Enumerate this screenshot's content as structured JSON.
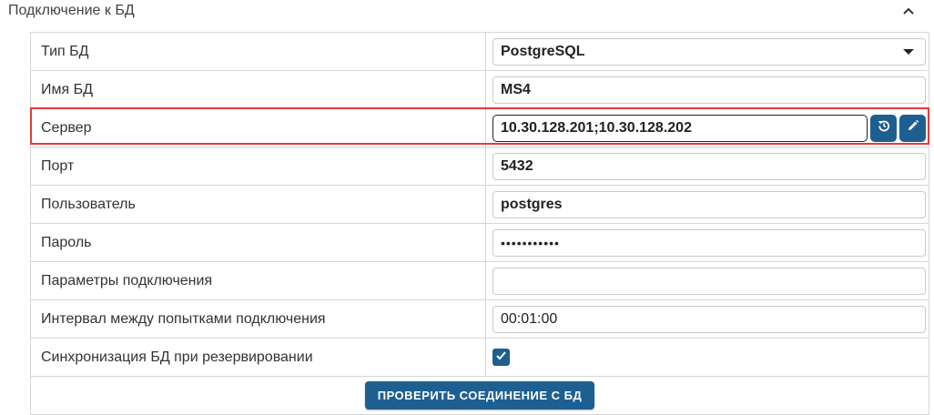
{
  "panel": {
    "title": "Подключение к БД"
  },
  "fields": {
    "db_type": {
      "label": "Тип БД",
      "value": "PostgreSQL"
    },
    "db_name": {
      "label": "Имя БД",
      "value": "MS4"
    },
    "server": {
      "label": "Сервер",
      "value": "10.30.128.201;10.30.128.202"
    },
    "port": {
      "label": "Порт",
      "value": "5432"
    },
    "user": {
      "label": "Пользователь",
      "value": "postgres"
    },
    "password": {
      "label": "Пароль",
      "value": "•••••••••••"
    },
    "params": {
      "label": "Параметры подключения",
      "value": ""
    },
    "interval": {
      "label": "Интервал между попытками подключения",
      "value": "00:01:00"
    },
    "sync": {
      "label": "Синхронизация БД при резервировании",
      "checked": true
    }
  },
  "buttons": {
    "test_connection": "ПРОВЕРИТЬ СОЕДИНЕНИЕ С БД"
  },
  "icons": {
    "collapse": "chevron-up-icon",
    "reset": "reset-icon",
    "edit": "pencil-icon",
    "dropdown": "caret-down-icon",
    "check": "checkmark-icon"
  },
  "colors": {
    "accent": "#1e5f91",
    "highlight": "#e23b3b"
  }
}
